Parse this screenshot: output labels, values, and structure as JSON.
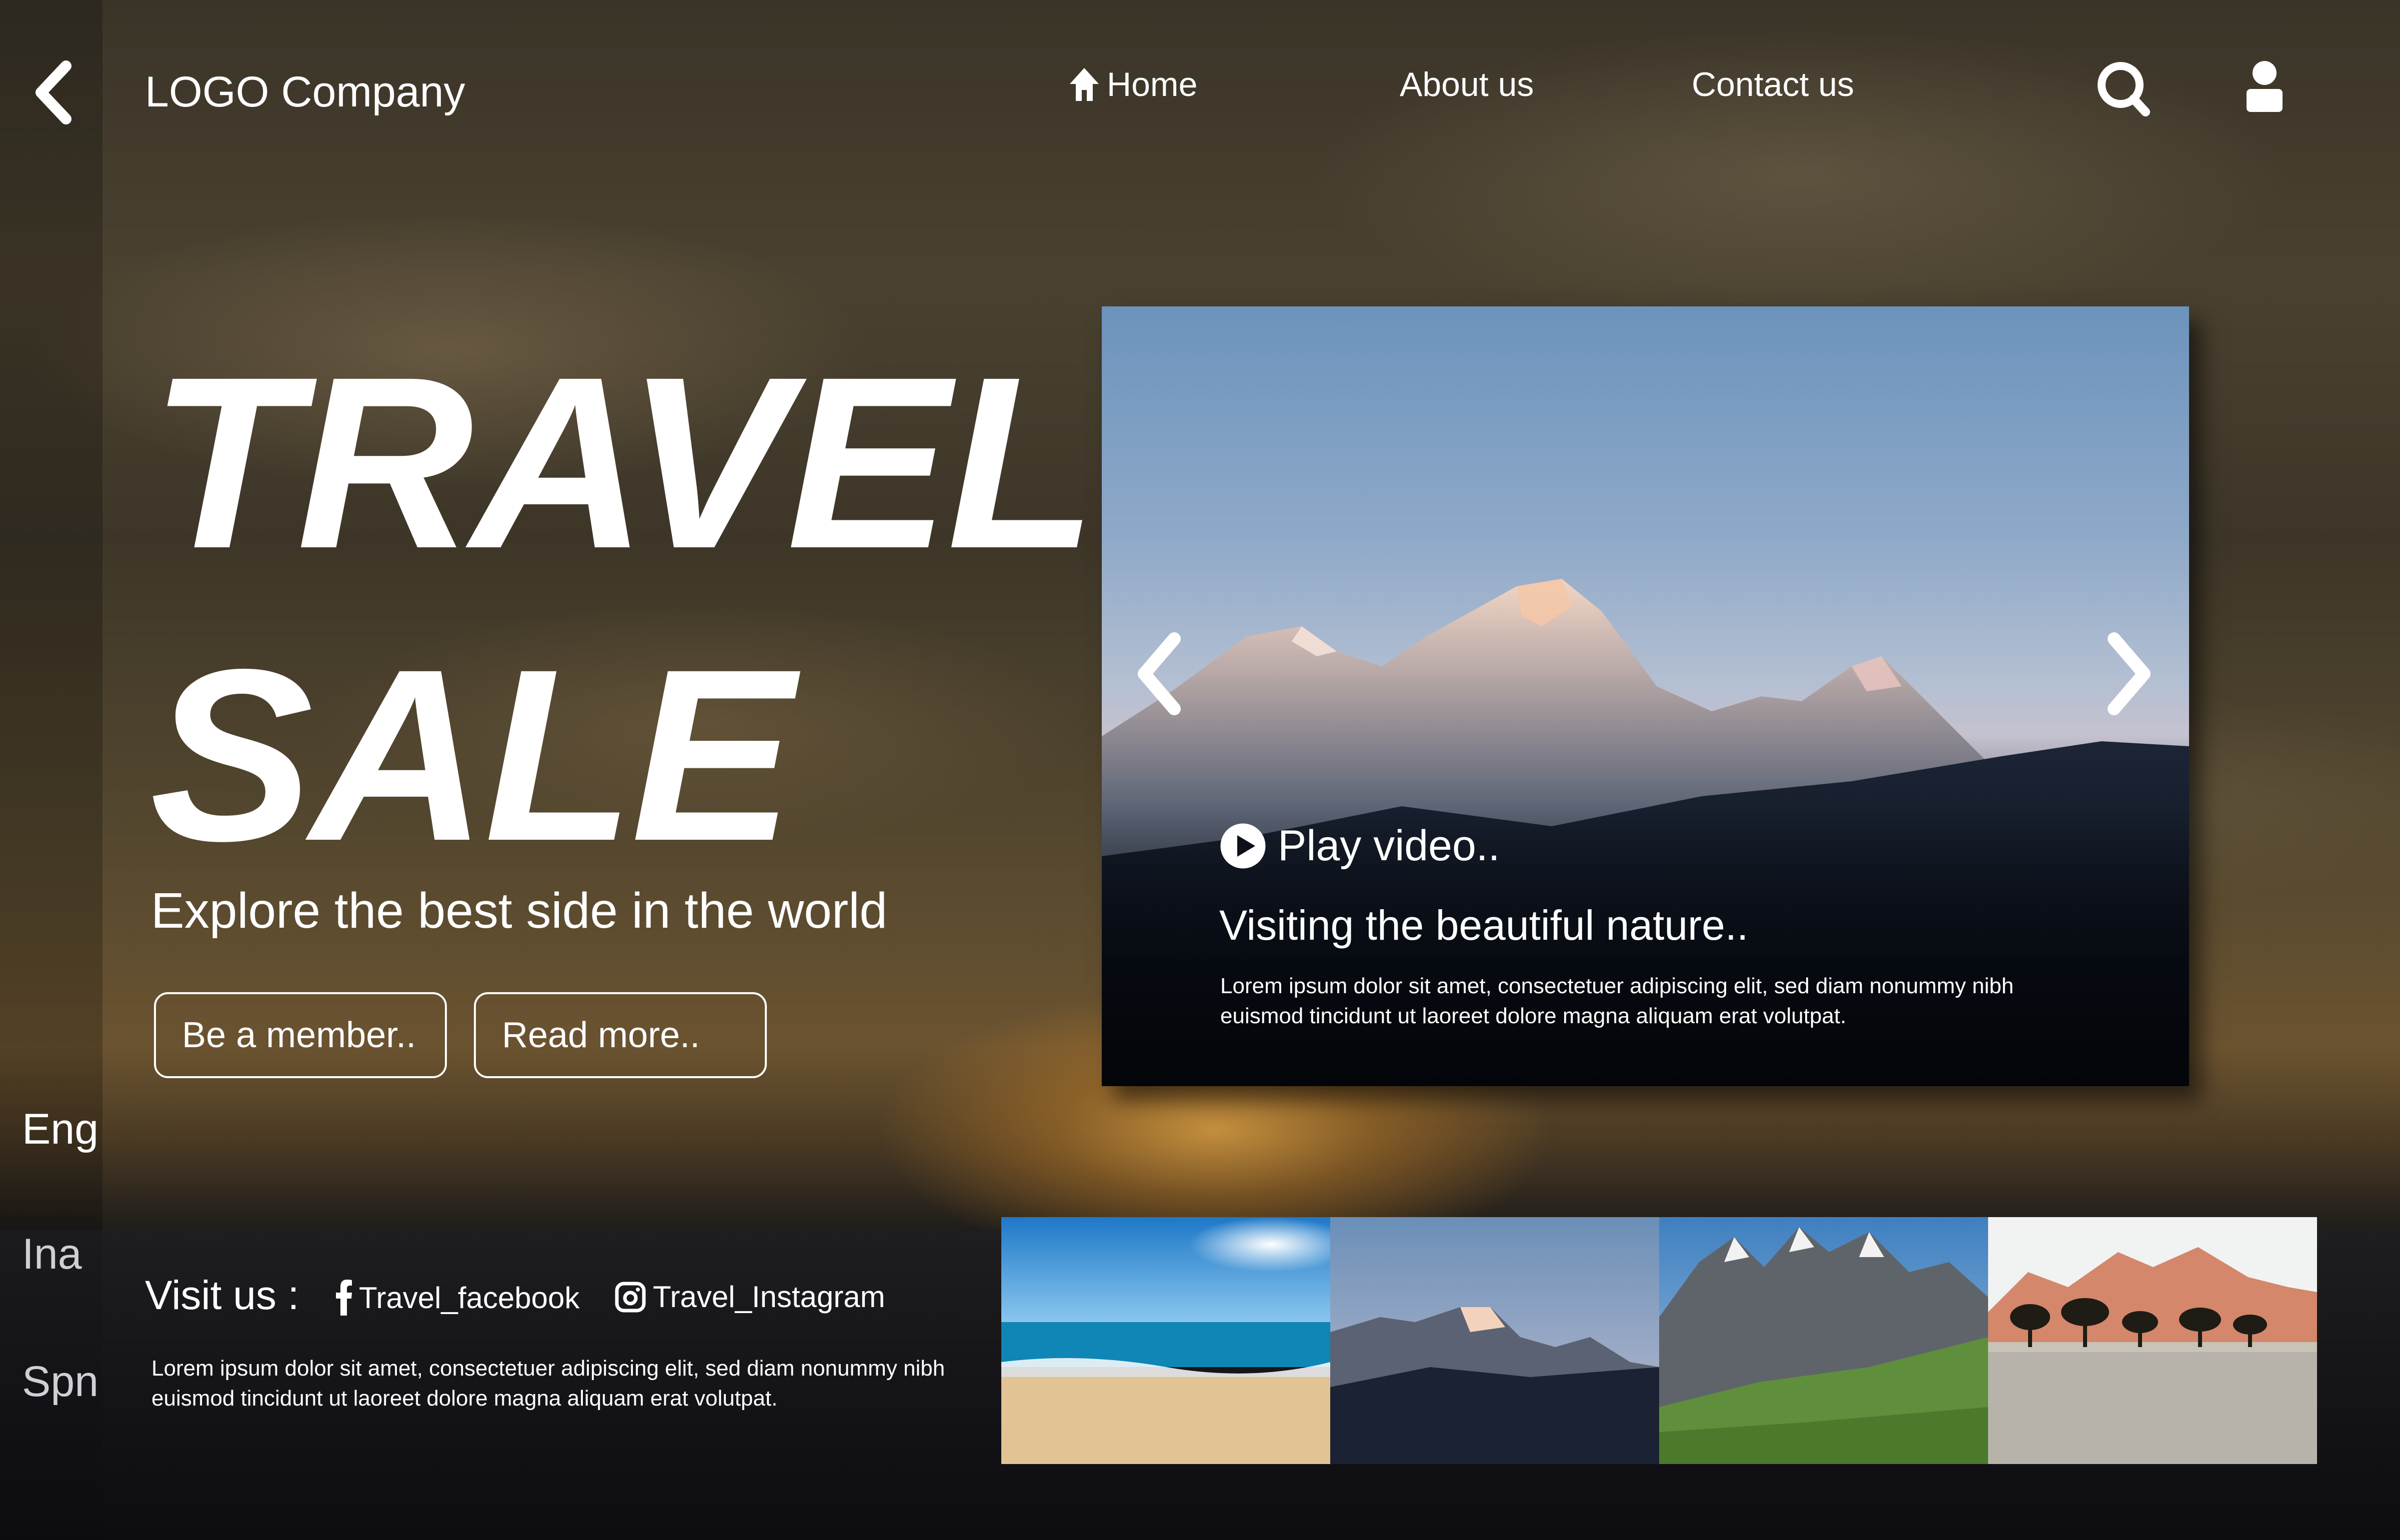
{
  "header": {
    "logo": "LOGO Company",
    "nav": {
      "home": "Home",
      "about": "About us",
      "contact": "Contact us"
    }
  },
  "hero": {
    "title_line1": "TRAVEL",
    "title_line2": "SALE",
    "subtitle": "Explore the best side in the world",
    "btn_member": "Be a member..",
    "btn_read": "Read more.."
  },
  "languages": [
    "Eng",
    "Ina",
    "Spn"
  ],
  "video": {
    "play_label": "Play video..",
    "title": "Visiting the beautiful nature..",
    "description": "Lorem ipsum dolor sit amet, consectetuer adipiscing elit, sed diam nonummy nibh euismod tincidunt ut laoreet dolore magna aliquam erat volutpat."
  },
  "footer": {
    "visit_label": "Visit us :",
    "facebook": "Travel_facebook",
    "instagram": "Travel_Instagram",
    "description": "Lorem ipsum dolor sit amet, consectetuer adipiscing elit, sed diam nonummy nibh euismod tincidunt ut laoreet dolore magna aliquam erat volutpat."
  },
  "icons": {
    "back": "chevron-left-icon",
    "home": "home-icon",
    "search": "search-icon",
    "user": "user-icon",
    "carousel_prev": "chevron-left-icon",
    "carousel_next": "chevron-right-icon",
    "play": "play-circle-icon",
    "facebook": "facebook-icon",
    "instagram": "instagram-icon"
  },
  "thumbnails": [
    "beach",
    "snowy-mountain-peak",
    "alpine-meadow-mountains",
    "savanna-mountains"
  ],
  "colors": {
    "text": "#ffffff",
    "background_dark": "#3a3428",
    "sunset_glow": "#eba846"
  }
}
